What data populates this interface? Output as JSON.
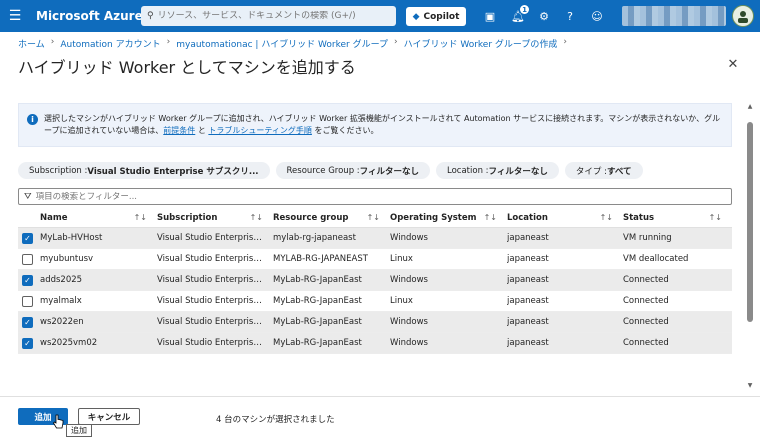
{
  "topbar": {
    "brand": "Microsoft Azure",
    "search_placeholder": "リソース、サービス、ドキュメントの検索 (G+/)",
    "copilot_label": "Copilot",
    "notification_count": "1",
    "accent_color": "#0f6cbd"
  },
  "breadcrumb": [
    "ホーム",
    "Automation アカウント",
    "myautomationac | ハイブリッド Worker グループ",
    "ハイブリッド Worker グループの作成"
  ],
  "page": {
    "title": "ハイブリッド Worker としてマシンを追加する"
  },
  "info": {
    "text": "選択したマシンがハイブリッド Worker グループに追加され、ハイブリッド Worker 拡張機能がインストールされて Automation サービスに接続されます。マシンが表示されないか、グループに追加されていない場合は、",
    "link1": "前提条件",
    "mid": " と ",
    "link2": "トラブルシューティング手順",
    "tail": " をご覧ください。"
  },
  "filters": [
    {
      "label": "Subscription : ",
      "value": "Visual Studio Enterprise サブスクリ..."
    },
    {
      "label": "Resource Group : ",
      "value": "フィルターなし"
    },
    {
      "label": "Location : ",
      "value": "フィルターなし"
    },
    {
      "label": "タイプ : ",
      "value": "すべて"
    }
  ],
  "search": {
    "placeholder": "項目の検索とフィルター..."
  },
  "table": {
    "headers": [
      "Name",
      "Subscription",
      "Resource group",
      "Operating System",
      "Location",
      "Status"
    ],
    "rows": [
      {
        "checked": true,
        "name": "MyLab-HVHost",
        "subscription": "Visual Studio Enterprise…",
        "rg": "mylab-rg-japaneast",
        "os": "Windows",
        "location": "japaneast",
        "status": "VM running"
      },
      {
        "checked": false,
        "name": "myubuntusv",
        "subscription": "Visual Studio Enterprise…",
        "rg": "MYLAB-RG-JAPANEAST",
        "os": "Linux",
        "location": "japaneast",
        "status": "VM deallocated"
      },
      {
        "checked": true,
        "name": "adds2025",
        "subscription": "Visual Studio Enterprise…",
        "rg": "MyLab-RG-JapanEast",
        "os": "Windows",
        "location": "japaneast",
        "status": "Connected"
      },
      {
        "checked": false,
        "name": "myalmalx",
        "subscription": "Visual Studio Enterprise…",
        "rg": "MyLab-RG-JapanEast",
        "os": "Linux",
        "location": "japaneast",
        "status": "Connected"
      },
      {
        "checked": true,
        "name": "ws2022en",
        "subscription": "Visual Studio Enterprise…",
        "rg": "MyLab-RG-JapanEast",
        "os": "Windows",
        "location": "japaneast",
        "status": "Connected"
      },
      {
        "checked": true,
        "name": "ws2025vm02",
        "subscription": "Visual Studio Enterprise…",
        "rg": "MyLab-RG-JapanEast",
        "os": "Windows",
        "location": "japaneast",
        "status": "Connected"
      }
    ]
  },
  "footer": {
    "add_label": "追加",
    "cancel_label": "キャンセル",
    "selected_text": "4 台のマシンが選択されました",
    "tooltip": "追加"
  }
}
